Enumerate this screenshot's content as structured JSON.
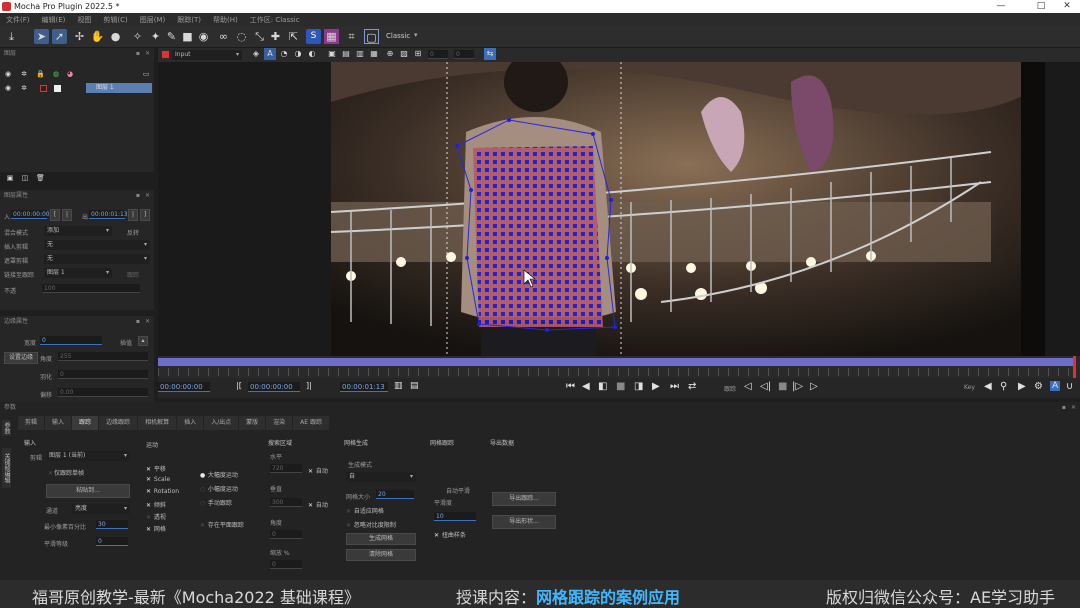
{
  "window": {
    "title": "Mocha Pro Plugin 2022.5 *",
    "minimize": "—",
    "maximize": "□",
    "close": "✕"
  },
  "menu": [
    "文件(F)",
    "编辑(E)",
    "视图",
    "剪辑(C)",
    "图层(M)",
    "跟踪(T)",
    "帮助(H)",
    "工作区: Classic"
  ],
  "toolbar": {
    "workspace": "Classic",
    "blue_s": "S"
  },
  "layers_panel": {
    "title": "图层",
    "layer_name": "图层 1"
  },
  "layer_props": {
    "title": "图层属性",
    "in_value": "00:00:00:00",
    "out_value": "00:00:01:13",
    "in_label": "入",
    "out_label": "出",
    "blend_label": "混合模式",
    "blend_value": "添加",
    "invert_label": "反转",
    "insert_clip_label": "插入剪辑",
    "insert_clip_value": "无",
    "insert_clip2_label": "遮罩剪辑",
    "insert_clip2_value": "无",
    "link_label": "链接至跟踪",
    "link_value": "图层 1",
    "link_btn": "跟踪",
    "opacity_label": "不透",
    "opacity_value": "100"
  },
  "edge_props": {
    "title": "边缘属性",
    "width_label": "宽度",
    "width_value": "0",
    "set_btn": "设置边缘",
    "angle_label": "角度",
    "angle_value": "255",
    "feather_label": "羽化",
    "feather_value": "0",
    "offset_label": "偏移",
    "offset_value": "0.00",
    "step_btn": "插值"
  },
  "viewer": {
    "clip_name": "Input",
    "nums": [
      "0",
      "0"
    ]
  },
  "transport": {
    "tc1": "00:00:00:00",
    "tc2": "00:00:00:00",
    "tc3": "00:00:01:13",
    "speed_label": "跟踪",
    "key_label": "Key"
  },
  "params": {
    "header": "参数",
    "side_tab1": "参数",
    "side_tab2": "关键帧编辑",
    "tabs": [
      "剪辑",
      "输入",
      "跟踪",
      "边缘跟踪",
      "相机解算",
      "插入",
      "入/出点",
      "蒙版",
      "渲染",
      "AE 跟踪"
    ],
    "input": {
      "title": "输入",
      "clip_label": "剪辑",
      "clip_value": "图层 1 (当前)",
      "track_individual": "仅跟踪单帧",
      "paste_btn": "粘贴到...",
      "preproc_label": "通道",
      "preproc_value": "亮度",
      "min_pix_label": "最小像素百分比",
      "min_pix_value": "30",
      "blur_label": "平滑等级",
      "blur_value": "0"
    },
    "motion": {
      "title": "运动",
      "translation": "平移",
      "scale": "Scale",
      "rotation": "Rotation",
      "shear": "倾斜",
      "perspective": "透视",
      "mesh": "网格",
      "large_motion": "大幅度运动",
      "small_motion": "小幅度运动",
      "manual": "手动跟踪",
      "existing": "存在平面跟踪"
    },
    "search_area": {
      "title": "搜索区域",
      "horizontal_label": "水平",
      "horizontal_value": "720",
      "auto1": "自动",
      "vertical_label": "垂直",
      "vertical_value": "300",
      "auto2": "自动",
      "angle_label": "角度",
      "angle_value": "0",
      "zoom_label": "缩放 %",
      "zoom_value": "0"
    },
    "mesh": {
      "title": "网格生成",
      "mode_label": "生成模式",
      "mode_value": "自",
      "mesh_size_label": "网格大小",
      "mesh_size_value": "20",
      "adaptive": "自适应网格",
      "fixed_contrast": "忽略对比度限制",
      "generate_btn": "生成网格",
      "clear_btn": "清除网格"
    },
    "mesh_track": {
      "title": "网格跟踪",
      "warp_label": "自动平滑",
      "smooth_label": "平滑度",
      "smooth_value": "10",
      "warp_spline": "扭曲样条"
    },
    "export": {
      "title": "导出数据",
      "export_btn": "导出跟踪...",
      "export_shape_btn": "导出形状..."
    }
  },
  "caption": {
    "left": "福哥原创教学-最新《Mocha2022 基础课程》",
    "mid_label": "授课内容：",
    "mid_highlight": "网格跟踪的案例应用",
    "right": "版权归微信公众号：AE学习助手"
  },
  "colors": {
    "accent": "#3d74c2",
    "mesh": "#1a1ad8",
    "caption_highlight": "#3fb8ff"
  }
}
